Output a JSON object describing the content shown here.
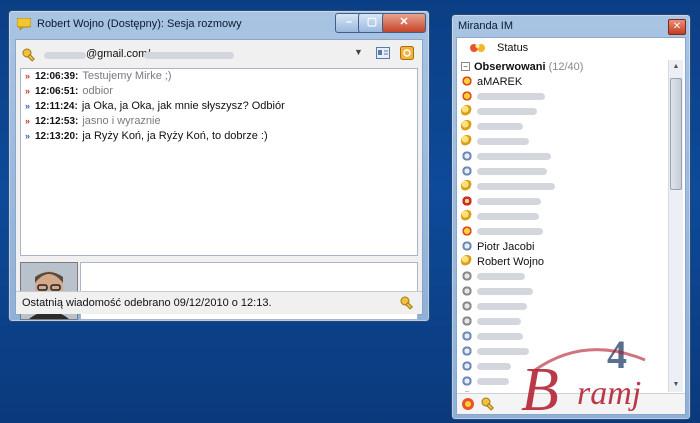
{
  "chat": {
    "title": "Robert Wojno (Dostępny): Sesja rozmowy",
    "contact_email": "@gmail.com/",
    "messages": [
      {
        "dir": "in",
        "time": "12:06:39:",
        "text": "Testujemy Mirke ;)"
      },
      {
        "dir": "in",
        "time": "12:06:51:",
        "text": "odbior"
      },
      {
        "dir": "out",
        "time": "12:11:24:",
        "text": "ja Oka, ja Oka, jak mnie słyszysz? Odbiór"
      },
      {
        "dir": "in",
        "time": "12:12:53:",
        "text": "jasno i wyraznie"
      },
      {
        "dir": "out",
        "time": "12:13:20:",
        "text": "ja Ryży Koń, ja Ryży Koń, to dobrze :)"
      }
    ],
    "status_text": "Ostatnią wiadomość odebrano 09/12/2010 o 12:13."
  },
  "miranda": {
    "title": "Miranda IM",
    "status_label": "Status",
    "group": {
      "name": "Obserwowani",
      "count": "(12/40)"
    },
    "contacts": [
      {
        "icon": "sun",
        "name": "aMAREK"
      },
      {
        "icon": "sun",
        "name": ""
      },
      {
        "icon": "key",
        "name": ""
      },
      {
        "icon": "key",
        "name": ""
      },
      {
        "icon": "key",
        "name": ""
      },
      {
        "icon": "blue",
        "name": ""
      },
      {
        "icon": "blue",
        "name": ""
      },
      {
        "icon": "key",
        "name": ""
      },
      {
        "icon": "red",
        "name": ""
      },
      {
        "icon": "key",
        "name": ""
      },
      {
        "icon": "sun",
        "name": ""
      },
      {
        "icon": "blue",
        "name": "Piotr Jacobi"
      },
      {
        "icon": "key",
        "name": "Robert Wojno"
      },
      {
        "icon": "gray",
        "name": ""
      },
      {
        "icon": "gray",
        "name": ""
      },
      {
        "icon": "gray",
        "name": ""
      },
      {
        "icon": "gray",
        "name": ""
      },
      {
        "icon": "blue",
        "name": ""
      },
      {
        "icon": "blue",
        "name": ""
      },
      {
        "icon": "blue",
        "name": ""
      },
      {
        "icon": "blue",
        "name": ""
      },
      {
        "icon": "gray",
        "name": ""
      },
      {
        "icon": "gray",
        "name": ""
      }
    ]
  },
  "watermark": {
    "text": "4 Bramj"
  },
  "colors": {
    "desktop": "#0b3f85",
    "incoming_arrow": "#c0392b",
    "outgoing_arrow": "#3a5fb0"
  }
}
